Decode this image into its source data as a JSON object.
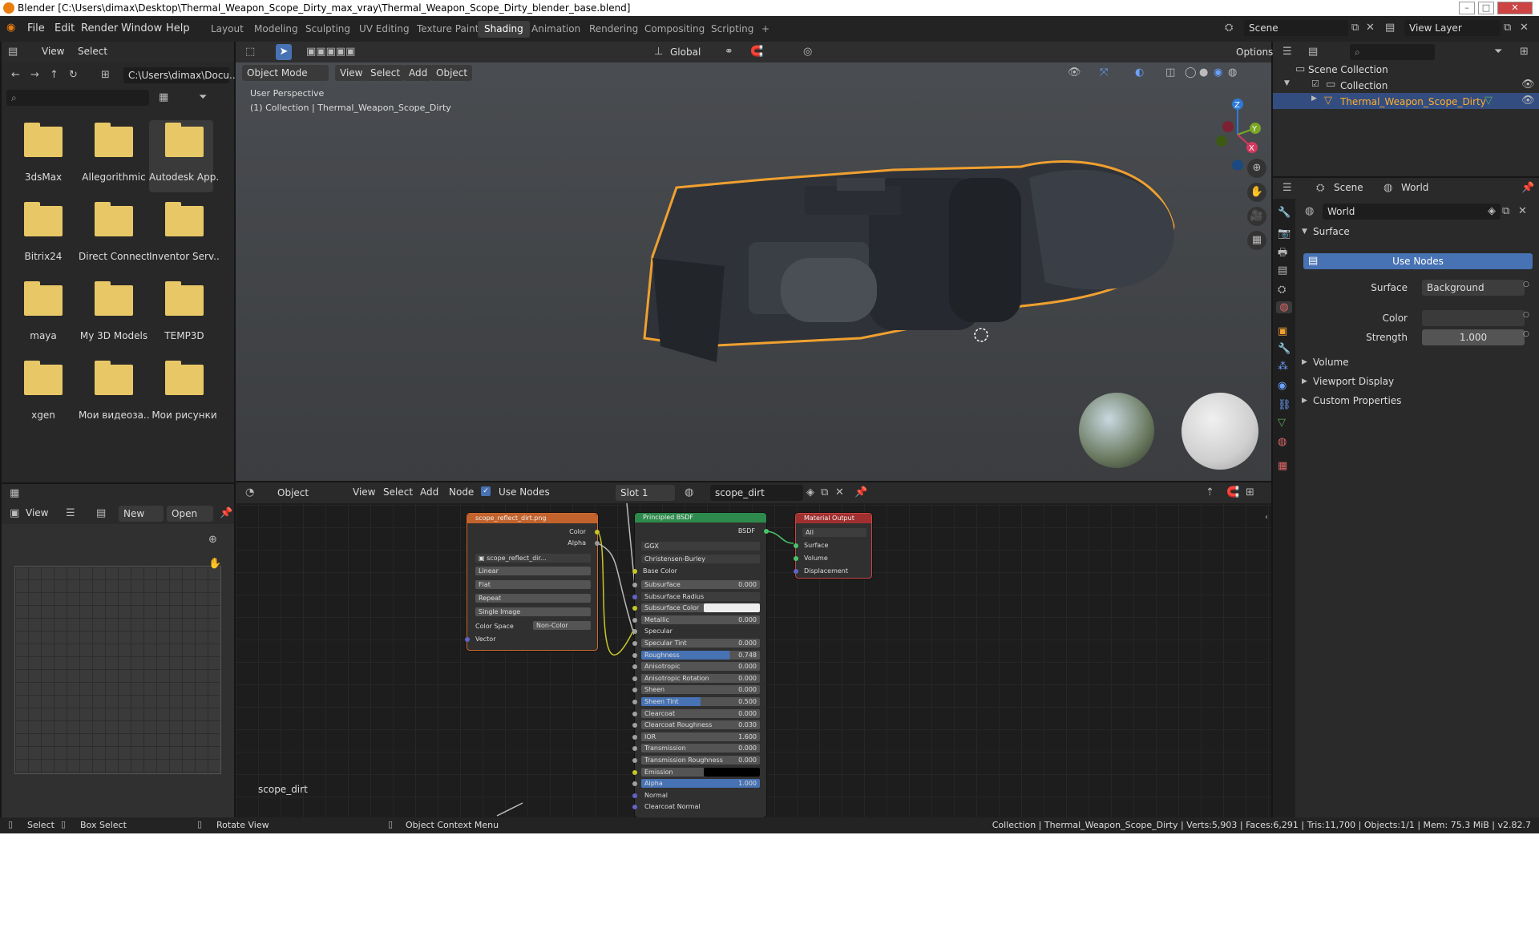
{
  "titlebar": {
    "title": "Blender [C:\\Users\\dimax\\Desktop\\Thermal_Weapon_Scope_Dirty_max_vray\\Thermal_Weapon_Scope_Dirty_blender_base.blend]",
    "min": "–",
    "max": "□",
    "close": "✕"
  },
  "menu": {
    "file": "File",
    "edit": "Edit",
    "render": "Render",
    "window": "Window",
    "help": "Help"
  },
  "workspaces": [
    "Layout",
    "Modeling",
    "Sculpting",
    "UV Editing",
    "Texture Paint",
    "Shading",
    "Animation",
    "Rendering",
    "Compositing",
    "Scripting",
    "+"
  ],
  "scene": {
    "label": "Scene",
    "view_layer": "View Layer"
  },
  "filebrowser": {
    "view": "View",
    "select": "Select",
    "path": "C:\\Users\\dimax\\Docu...",
    "search_placeholder": "",
    "folders": [
      "3dsMax",
      "Allegorithmic",
      "Autodesk App...",
      "Bitrix24",
      "Direct Connect",
      "Inventor Serv...",
      "maya",
      "My 3D Models",
      "TEMP3D",
      "xgen",
      "Мои видеоза...",
      "Мои рисунки"
    ]
  },
  "viewport": {
    "mode": "Object Mode",
    "view": "View",
    "select": "Select",
    "add": "Add",
    "object": "Object",
    "transform": "Global",
    "options": "Options",
    "overlay_line1": "User Perspective",
    "overlay_line2": "(1) Collection | Thermal_Weapon_Scope_Dirty",
    "axis_x": "X",
    "axis_y": "Y",
    "axis_z": "Z"
  },
  "imageeditor": {
    "view": "View",
    "new": "New",
    "open": "Open"
  },
  "nodeeditor": {
    "object": "Object",
    "view": "View",
    "select": "Select",
    "add": "Add",
    "node": "Node",
    "use_nodes": "Use Nodes",
    "slot": "Slot 1",
    "material": "scope_dirt",
    "corner_label": "scope_dirt",
    "image_node": {
      "title": "scope_reflect_dirt.png",
      "out_color": "Color",
      "out_alpha": "Alpha",
      "image": "scope_reflect_dir...",
      "interp": "Linear",
      "proj": "Flat",
      "ext": "Repeat",
      "source": "Single Image",
      "cs_label": "Color Space",
      "cs_value": "Non-Color",
      "vector": "Vector"
    },
    "bsdf": {
      "title": "Principled BSDF",
      "out": "BSDF",
      "dist": "GGX",
      "sss_method": "Christensen-Burley",
      "base_color": "Base Color",
      "fields": [
        [
          "Subsurface",
          "0.000"
        ],
        [
          "Subsurface Radius",
          ""
        ],
        [
          "Subsurface Color",
          ""
        ],
        [
          "Metallic",
          "0.000"
        ],
        [
          "Specular",
          ""
        ],
        [
          "Specular Tint",
          "0.000"
        ],
        [
          "Roughness",
          "0.748"
        ],
        [
          "Anisotropic",
          "0.000"
        ],
        [
          "Anisotropic Rotation",
          "0.000"
        ],
        [
          "Sheen",
          "0.000"
        ],
        [
          "Sheen Tint",
          "0.500"
        ],
        [
          "Clearcoat",
          "0.000"
        ],
        [
          "Clearcoat Roughness",
          "0.030"
        ],
        [
          "IOR",
          "1.600"
        ],
        [
          "Transmission",
          "0.000"
        ],
        [
          "Transmission Roughness",
          "0.000"
        ],
        [
          "Emission",
          ""
        ],
        [
          "Alpha",
          "1.000"
        ],
        [
          "Normal",
          ""
        ],
        [
          "Clearcoat Normal",
          ""
        ]
      ]
    },
    "output": {
      "title": "Material Output",
      "target": "All",
      "surface": "Surface",
      "volume": "Volume",
      "displacement": "Displacement"
    }
  },
  "outliner": {
    "scene_collection": "Scene Collection",
    "collection": "Collection",
    "object": "Thermal_Weapon_Scope_Dirty"
  },
  "properties": {
    "scene": "Scene",
    "world": "World",
    "world_name": "World",
    "surface_section": "Surface",
    "use_nodes": "Use Nodes",
    "surface_label": "Surface",
    "surface_value": "Background",
    "color_label": "Color",
    "strength_label": "Strength",
    "strength_value": "1.000",
    "volume": "Volume",
    "viewport_display": "Viewport Display",
    "custom_properties": "Custom Properties"
  },
  "statusbar": {
    "select": "Select",
    "box_select": "Box Select",
    "rotate": "Rotate View",
    "context": "Object Context Menu",
    "stats": "Collection | Thermal_Weapon_Scope_Dirty | Verts:5,903 | Faces:6,291 | Tris:11,700 | Objects:1/1 | Mem: 75.3 MiB | v2.82.7"
  },
  "colors": {
    "accent_blue": "#4772b3",
    "selection_orange": "#f0a030",
    "folder": "#e8c766",
    "node_image": "#c2622c",
    "node_shader": "#2e8a4c",
    "node_output": "#a03030"
  }
}
